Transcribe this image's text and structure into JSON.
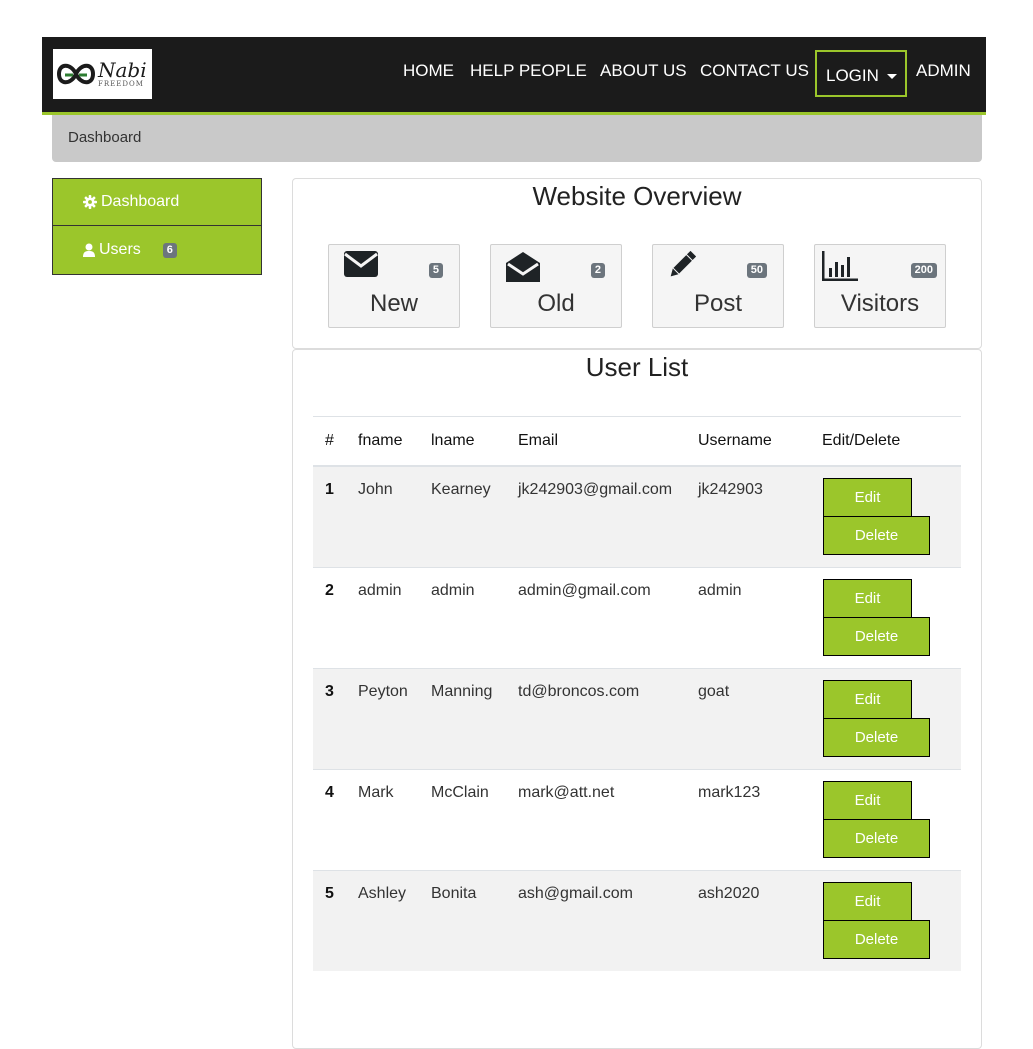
{
  "brand": {
    "logo_main": "Nabi",
    "logo_sub": "FREEDOM"
  },
  "nav": {
    "home": "HOME",
    "help": "HELP PEOPLE",
    "about": "ABOUT US",
    "contact": "CONTACT US",
    "login": "LOGIN",
    "admin": "ADMIN"
  },
  "breadcrumb": "Dashboard",
  "sidebar": {
    "items": [
      {
        "label": "Dashboard",
        "icon": "gear-icon"
      },
      {
        "label": "Users",
        "icon": "user-icon",
        "badge": "6"
      }
    ]
  },
  "overview": {
    "title": "Website Overview",
    "stats": [
      {
        "label": "New",
        "count": "5",
        "icon": "envelope-closed-icon"
      },
      {
        "label": "Old",
        "count": "2",
        "icon": "envelope-open-icon"
      },
      {
        "label": "Post",
        "count": "50",
        "icon": "pencil-icon"
      },
      {
        "label": "Visitors",
        "count": "200",
        "icon": "bar-chart-icon"
      }
    ]
  },
  "userlist": {
    "title": "User List",
    "headers": [
      "#",
      "fname",
      "lname",
      "Email",
      "Username",
      "Edit/Delete"
    ],
    "edit_label": "Edit",
    "delete_label": "Delete",
    "rows": [
      {
        "num": "1",
        "fname": "John",
        "lname": "Kearney",
        "email": "jk242903@gmail.com",
        "username": "jk242903"
      },
      {
        "num": "2",
        "fname": "admin",
        "lname": "admin",
        "email": "admin@gmail.com",
        "username": "admin"
      },
      {
        "num": "3",
        "fname": "Peyton",
        "lname": "Manning",
        "email": "td@broncos.com",
        "username": "goat"
      },
      {
        "num": "4",
        "fname": "Mark",
        "lname": "McClain",
        "email": "mark@att.net",
        "username": "mark123"
      },
      {
        "num": "5",
        "fname": "Ashley",
        "lname": "Bonita",
        "email": "ash@gmail.com",
        "username": "ash2020"
      }
    ]
  },
  "colors": {
    "accent": "#9bc62b",
    "navbar": "#1b1b1b",
    "breadcrumb_bg": "#c9c9c9",
    "badge": "#6c757d"
  }
}
